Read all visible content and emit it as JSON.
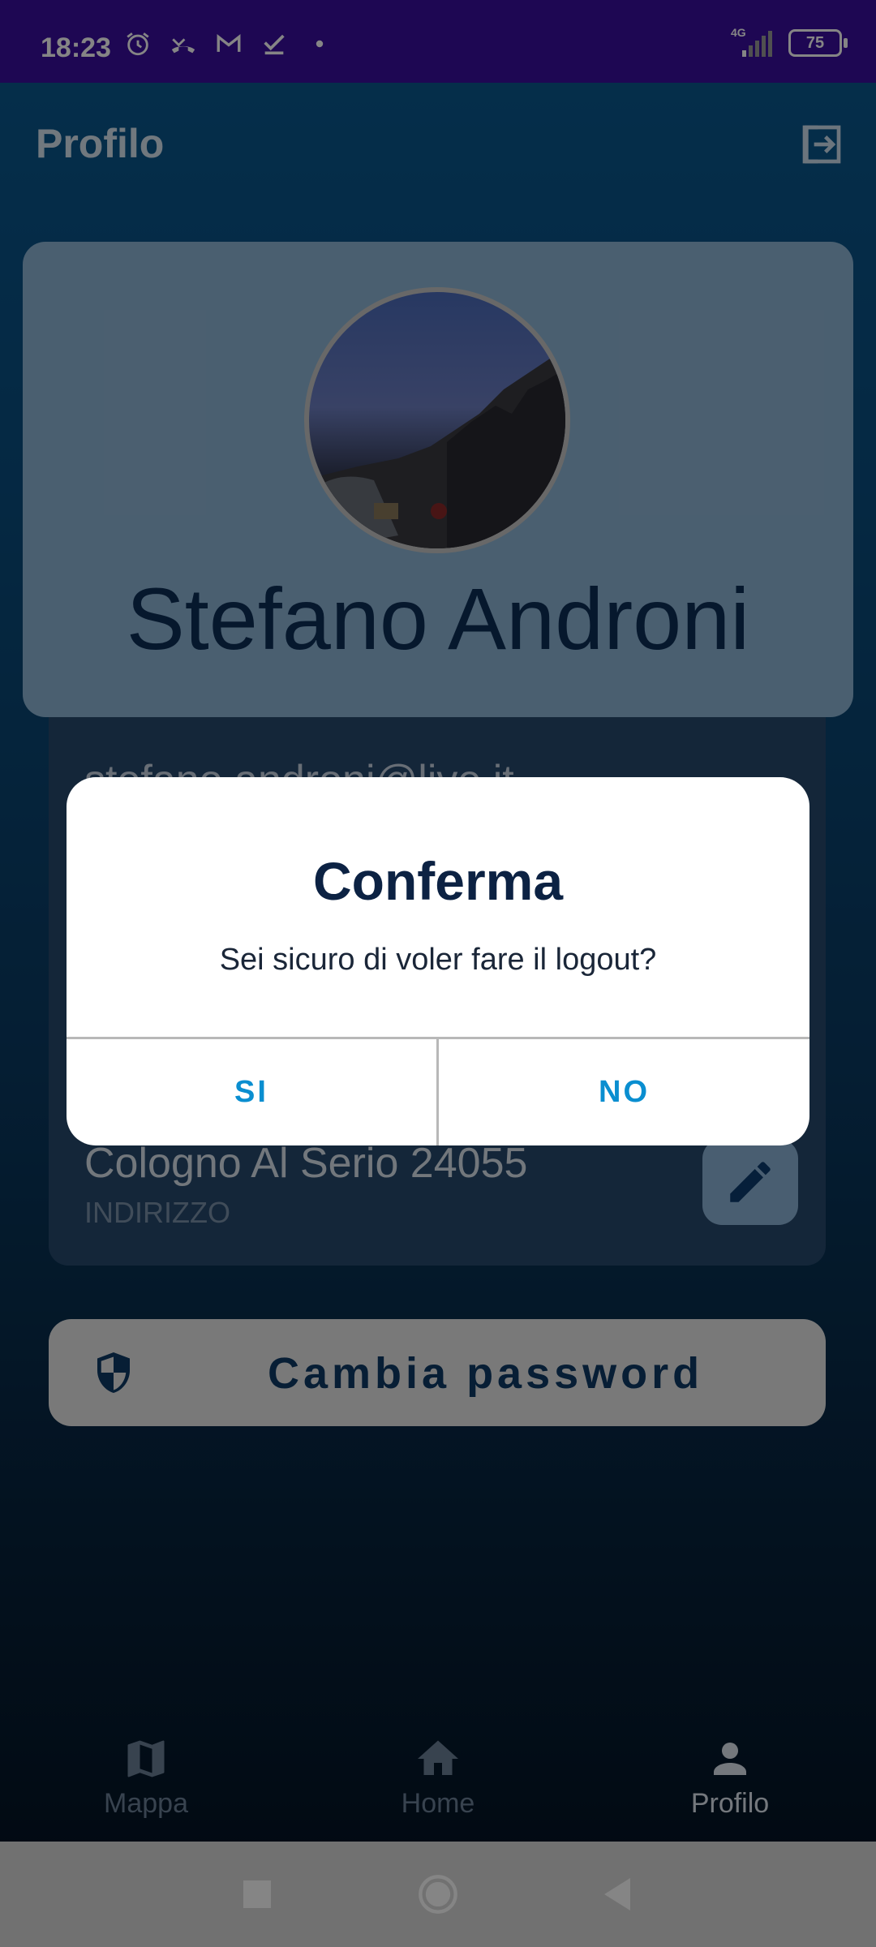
{
  "statusbar": {
    "time": "18:23",
    "network": "4G",
    "battery": "75",
    "icons": [
      "alarm-icon",
      "missed-call-icon",
      "gmail-icon",
      "check-icon",
      "dot-icon"
    ]
  },
  "header": {
    "title": "Profilo",
    "logout_icon": "logout-icon"
  },
  "profile": {
    "name": "Stefano Androni",
    "email": "stefano.androni@live.it",
    "address": "Cologno Al Serio 24055",
    "address_label": "INDIRIZZO"
  },
  "actions": {
    "change_password": "Cambia password"
  },
  "bottom_nav": {
    "items": [
      {
        "label": "Mappa",
        "icon": "map-icon",
        "active": false
      },
      {
        "label": "Home",
        "icon": "home-icon",
        "active": false
      },
      {
        "label": "Profilo",
        "icon": "person-icon",
        "active": true
      }
    ]
  },
  "dialog": {
    "title": "Conferma",
    "message": "Sei sicuro di voler fare il logout?",
    "yes_label": "SI",
    "no_label": "NO"
  },
  "colors": {
    "statusbar": "#3a0fa0",
    "accent": "#0a8ed0",
    "dialog_title": "#0c2243"
  }
}
